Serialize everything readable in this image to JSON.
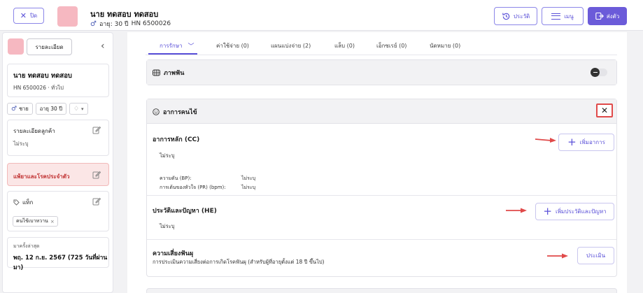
{
  "header": {
    "close_label": "ปิด",
    "patient_name": "นาย ทดสอบ ทดสอบ",
    "patient_age": "อายุ: 30 ปี",
    "patient_hn": "HN 6500026",
    "history_label": "ประวัติ",
    "menu_label": "เมนู",
    "send_label": "ส่งตัว"
  },
  "sidebar": {
    "detail_button": "รายละเอียด",
    "patient_name": "นาย ทดสอบ ทดสอบ",
    "hn_line": "HN 6500026 · ทั่วไป",
    "gender_chip": "ชาย",
    "age_chip": "อายุ 30 ปี",
    "customer_details_title": "รายละเอียดลูกค้า",
    "customer_details_value": "ไม่ระบุ",
    "allergy_title": "แพ้ยาและโรคประจำตัว",
    "tag_title": "แท็ก",
    "tag_value": "คนไข้เบาหวาน",
    "last_visit_label": "มาครั้งล่าสุด",
    "last_visit_value": "พฤ. 12 ก.ย. 2567 (725 วันที่ผ่านมา)"
  },
  "tabs": [
    {
      "label": "การรักษา"
    },
    {
      "label": "ค่าใช้จ่าย (0)"
    },
    {
      "label": "แผนแบ่งจ่าย (2)"
    },
    {
      "label": "แล็บ (0)"
    },
    {
      "label": "เอ็กซเรย์ (0)"
    },
    {
      "label": "นัดหมาย (0)"
    }
  ],
  "dental_chart": {
    "title": "ภาพฟัน"
  },
  "symptoms": {
    "title": "อาการคนไข้",
    "chief_complaint": {
      "title": "อาการหลัก (CC)",
      "value": "ไม่ระบุ",
      "add_label": "เพิ่มอาการ",
      "bp_label": "ความดัน (BP):",
      "bp_value": "ไม่ระบุ",
      "pr_label": "การเต้นของหัวใจ (PR) (bpm):",
      "pr_value": "ไม่ระบุ"
    },
    "history": {
      "title": "ประวัติและปัญหา (HE)",
      "value": "ไม่ระบุ",
      "add_label": "เพิ่มประวัติและปัญหา"
    },
    "gum_risk": {
      "title": "ความเสี่ยงฟันผุ",
      "description": "การประเมินความเสี่ยงต่อการเกิดโรคฟันผุ (สำหรับผู้ที่อายุตั้งแต่ 18 ปี ขึ้นไป)",
      "assess_label": "ประเมิน"
    }
  },
  "colors": {
    "accent": "#5a50d8",
    "annotation": "#e04a4a",
    "avatar": "#f6b8c1"
  }
}
